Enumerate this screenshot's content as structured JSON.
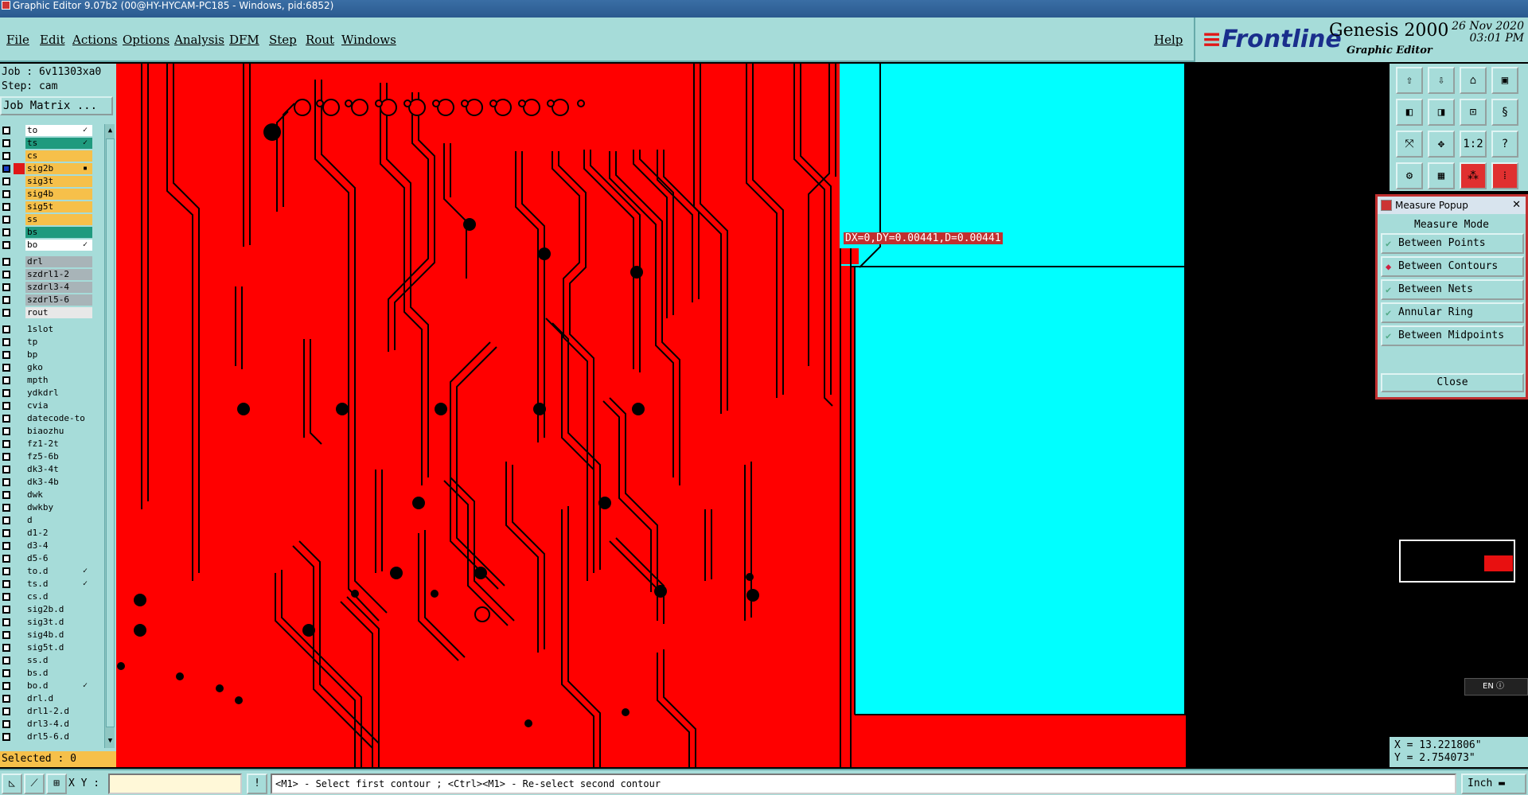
{
  "window": {
    "title": "Graphic Editor 9.07b2 (00@HY-HYCAM-PC185 - Windows, pid:6852)"
  },
  "menu": {
    "items": [
      "File",
      "Edit",
      "Actions",
      "Options",
      "Analysis",
      "DFM",
      "Step",
      "Rout",
      "Windows"
    ],
    "help": "Help"
  },
  "brand": {
    "logo": "Frontline",
    "product": "Genesis 2000",
    "subtitle": "Graphic Editor",
    "date": "26 Nov 2020",
    "time": "03:01 PM"
  },
  "job": {
    "job": "Job : 6v11303xa0",
    "step": "Step: cam",
    "matrix_button": "Job Matrix ..."
  },
  "layers": [
    {
      "name": "to",
      "color": "#ffffff",
      "marker": "✓"
    },
    {
      "name": "ts",
      "color": "#1f9a7e",
      "marker": "✓"
    },
    {
      "name": "cs",
      "color": "#f6c04a",
      "marker": ""
    },
    {
      "name": "sig2b",
      "color": "#f6c04a",
      "marker": "▪",
      "active": true
    },
    {
      "name": "sig3t",
      "color": "#f6c04a",
      "marker": ""
    },
    {
      "name": "sig4b",
      "color": "#f6c04a",
      "marker": ""
    },
    {
      "name": "sig5t",
      "color": "#f6c04a",
      "marker": ""
    },
    {
      "name": "ss",
      "color": "#f6c04a",
      "marker": ""
    },
    {
      "name": "bs",
      "color": "#1f9a7e",
      "marker": ""
    },
    {
      "name": "bo",
      "color": "#ffffff",
      "marker": "✓"
    },
    {
      "name": "drl",
      "color": "#a8b4b8",
      "marker": "",
      "gap": true
    },
    {
      "name": "szdrl1-2",
      "color": "#a8b4b8",
      "marker": ""
    },
    {
      "name": "szdrl3-4",
      "color": "#a8b4b8",
      "marker": ""
    },
    {
      "name": "szdrl5-6",
      "color": "#a8b4b8",
      "marker": ""
    },
    {
      "name": "rout",
      "color": "#e8e8e8",
      "marker": ""
    },
    {
      "name": "1slot",
      "color": "#a6dcd9",
      "marker": "",
      "gap": true
    },
    {
      "name": "tp",
      "color": "#a6dcd9",
      "marker": ""
    },
    {
      "name": "bp",
      "color": "#a6dcd9",
      "marker": ""
    },
    {
      "name": "gko",
      "color": "#a6dcd9",
      "marker": ""
    },
    {
      "name": "mpth",
      "color": "#a6dcd9",
      "marker": ""
    },
    {
      "name": "ydkdrl",
      "color": "#a6dcd9",
      "marker": ""
    },
    {
      "name": "cvia",
      "color": "#a6dcd9",
      "marker": ""
    },
    {
      "name": "datecode-to",
      "color": "#a6dcd9",
      "marker": ""
    },
    {
      "name": "biaozhu",
      "color": "#a6dcd9",
      "marker": ""
    },
    {
      "name": "fz1-2t",
      "color": "#a6dcd9",
      "marker": ""
    },
    {
      "name": "fz5-6b",
      "color": "#a6dcd9",
      "marker": ""
    },
    {
      "name": "dk3-4t",
      "color": "#a6dcd9",
      "marker": ""
    },
    {
      "name": "dk3-4b",
      "color": "#a6dcd9",
      "marker": ""
    },
    {
      "name": "dwk",
      "color": "#a6dcd9",
      "marker": ""
    },
    {
      "name": "dwkby",
      "color": "#a6dcd9",
      "marker": ""
    },
    {
      "name": "d",
      "color": "#a6dcd9",
      "marker": ""
    },
    {
      "name": "d1-2",
      "color": "#a6dcd9",
      "marker": ""
    },
    {
      "name": "d3-4",
      "color": "#a6dcd9",
      "marker": ""
    },
    {
      "name": "d5-6",
      "color": "#a6dcd9",
      "marker": ""
    },
    {
      "name": "to.d",
      "color": "#a6dcd9",
      "marker": "✓"
    },
    {
      "name": "ts.d",
      "color": "#a6dcd9",
      "marker": "✓"
    },
    {
      "name": "cs.d",
      "color": "#a6dcd9",
      "marker": ""
    },
    {
      "name": "sig2b.d",
      "color": "#a6dcd9",
      "marker": ""
    },
    {
      "name": "sig3t.d",
      "color": "#a6dcd9",
      "marker": ""
    },
    {
      "name": "sig4b.d",
      "color": "#a6dcd9",
      "marker": ""
    },
    {
      "name": "sig5t.d",
      "color": "#a6dcd9",
      "marker": ""
    },
    {
      "name": "ss.d",
      "color": "#a6dcd9",
      "marker": ""
    },
    {
      "name": "bs.d",
      "color": "#a6dcd9",
      "marker": ""
    },
    {
      "name": "bo.d",
      "color": "#a6dcd9",
      "marker": "✓"
    },
    {
      "name": "drl.d",
      "color": "#a6dcd9",
      "marker": ""
    },
    {
      "name": "drl1-2.d",
      "color": "#a6dcd9",
      "marker": ""
    },
    {
      "name": "drl3-4.d",
      "color": "#a6dcd9",
      "marker": ""
    },
    {
      "name": "drl5-6.d",
      "color": "#a6dcd9",
      "marker": ""
    }
  ],
  "selected": "Selected : 0",
  "measure_popup": {
    "title": "Measure Popup",
    "mode_label": "Measure Mode",
    "options": [
      {
        "label": "Between Points",
        "selected": false
      },
      {
        "label": "Between Contours",
        "selected": true
      },
      {
        "label": "Between Nets",
        "selected": false
      },
      {
        "label": "Annular Ring",
        "selected": false
      },
      {
        "label": "Between Midpoints",
        "selected": false
      }
    ],
    "close": "Close"
  },
  "measurement": "DX=0,DY=0.00441,D=0.00441",
  "coords": {
    "x": "X = 13.221806\"",
    "y": "Y = 2.754073\""
  },
  "status": {
    "xy_label": "X Y :",
    "xy_value": "",
    "prompt": "<M1> - Select first contour ; <Ctrl><M1> - Re-select second contour",
    "unit": "Inch"
  },
  "lang": "EN",
  "colors": {
    "board": "#ff0000",
    "pad": "#00ffff",
    "panel": "#a6dcd9"
  },
  "toolbar_icons": [
    "layer-up-icon",
    "layer-down-icon",
    "home-icon",
    "window-icon",
    "step-left-icon",
    "step-right-icon",
    "zoom-in-icon",
    "zoom-out-icon",
    "fit-icon",
    "center-icon",
    "scale-1-2-icon",
    "help-icon",
    "snap-icon",
    "grid-icon",
    "net-icon",
    "layer-select-icon"
  ]
}
